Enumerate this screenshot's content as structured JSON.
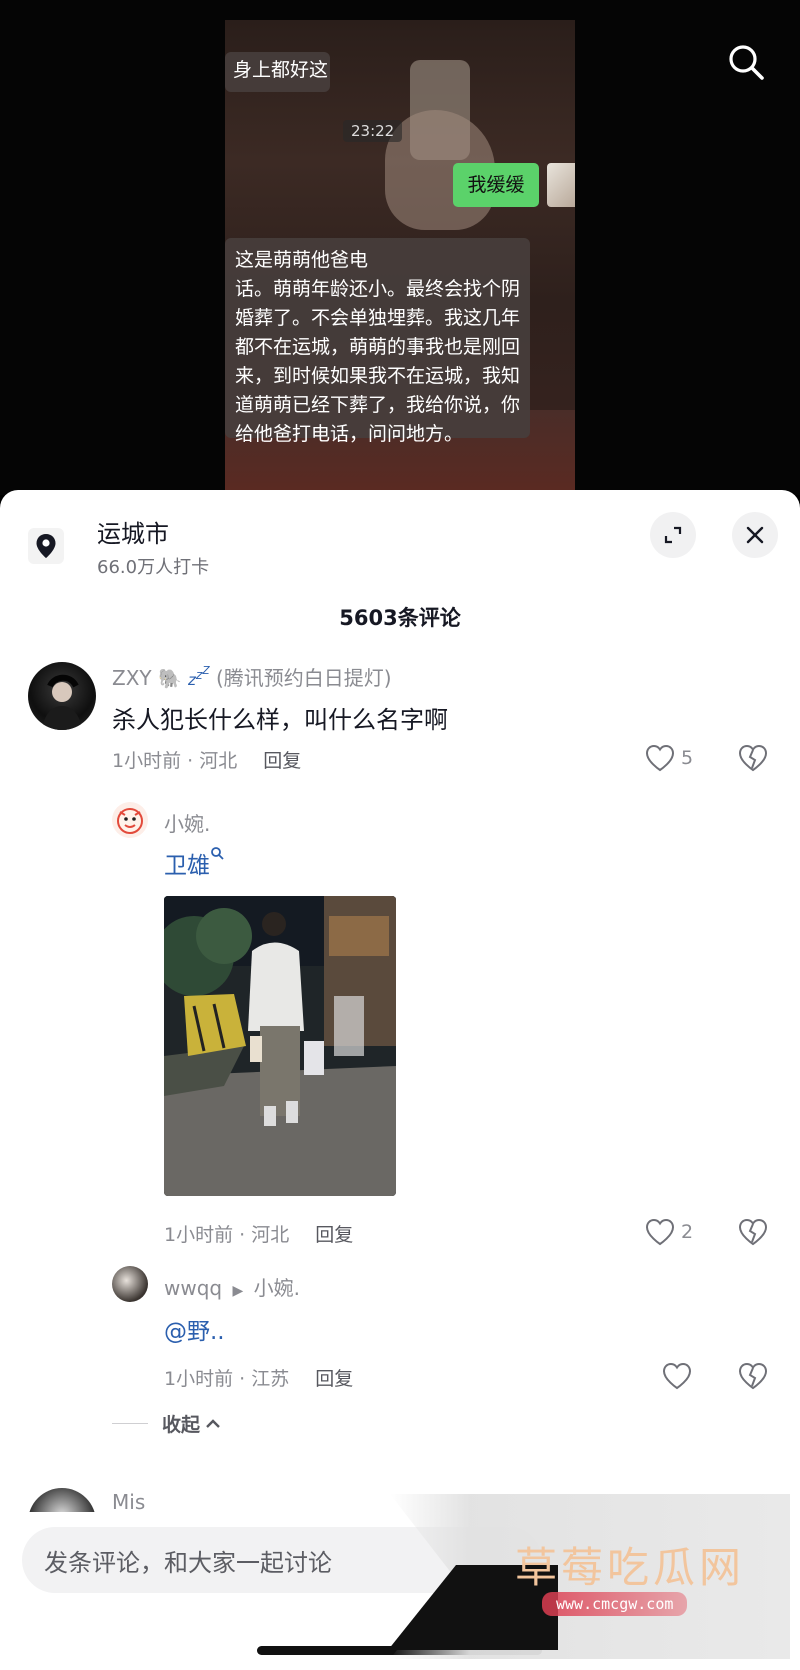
{
  "video": {
    "chat_top_text": "身上都好这",
    "chat_time": "23:22",
    "chat_green_text": "我缓缓",
    "chat_long_text": "这是萌萌他爸电\n话。萌萌年龄还小。最终会找个阴\n婚葬了。不会单独埋葬。我这几年\n都不在运城，萌萌的事我也是刚回\n来，到时候如果我不在运城，我知\n道萌萌已经下葬了，我给你说，你\n给他爸打电话，问问地方。"
  },
  "location": {
    "title": "运城市",
    "subtitle": "66.0万人打卡"
  },
  "comment_count": "5603条评论",
  "comments": [
    {
      "username": "ZXY",
      "badge": "(腾讯预约白日提灯)",
      "text": "杀人犯长什么样，叫什么名字啊",
      "meta": "1小时前 · 河北",
      "reply": "回复",
      "likes": "5"
    },
    {
      "username": "小婉.",
      "text": "卫雄",
      "meta": "1小时前 · 河北",
      "reply": "回复",
      "likes": "2"
    },
    {
      "username": "wwqq",
      "reply_to": "小婉.",
      "text": "@野..",
      "meta": "1小时前 · 江苏",
      "reply": "回复",
      "likes": ""
    }
  ],
  "collapse_label": "收起",
  "next_comment_username": "Mis",
  "input_placeholder": "发条评论，和大家一起讨论",
  "watermark": {
    "title": "草莓吃瓜网",
    "url": "www.cmcgw.com"
  },
  "colors": {
    "chat_green": "#5bd26a",
    "link_blue": "#2b5fae",
    "text_primary": "#161823",
    "text_secondary": "#8a8b91"
  }
}
